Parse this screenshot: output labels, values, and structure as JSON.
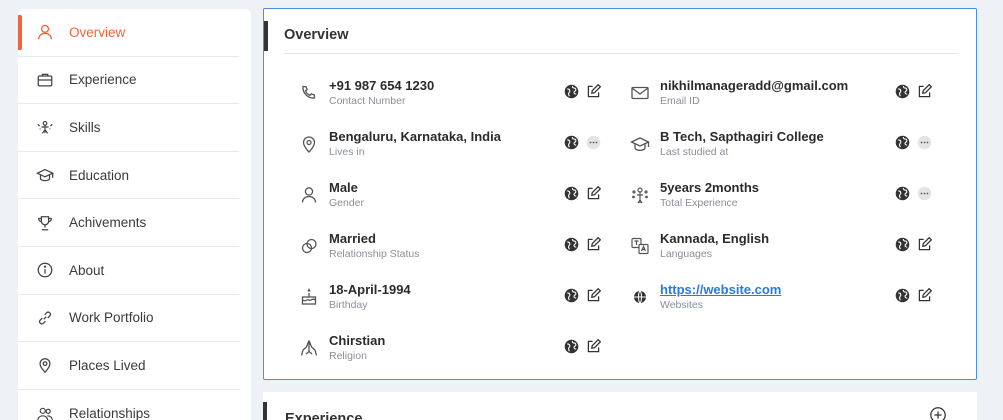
{
  "sidebar": {
    "items": [
      {
        "label": "Overview",
        "icon": "person-icon",
        "active": true
      },
      {
        "label": "Experience",
        "icon": "briefcase-icon",
        "active": false
      },
      {
        "label": "Skills",
        "icon": "skills-icon",
        "active": false
      },
      {
        "label": "Education",
        "icon": "graduation-cap-icon",
        "active": false
      },
      {
        "label": "Achivements",
        "icon": "trophy-icon",
        "active": false
      },
      {
        "label": "About",
        "icon": "info-icon",
        "active": false
      },
      {
        "label": "Work Portfolio",
        "icon": "link-icon",
        "active": false
      },
      {
        "label": "Places Lived",
        "icon": "location-pin-icon",
        "active": false
      },
      {
        "label": "Relationships",
        "icon": "people-icon",
        "active": false
      }
    ],
    "accent_color": "#f0643c"
  },
  "overview": {
    "title": "Overview",
    "fields": [
      {
        "value": "+91 987 654 1230",
        "caption": "Contact Number",
        "icon": "phone-icon",
        "action": "edit"
      },
      {
        "value": "nikhilmanageradd@gmail.com",
        "caption": "Email ID",
        "icon": "mail-icon",
        "action": "edit"
      },
      {
        "value": "Bengaluru, Karnataka, India",
        "caption": "Lives in",
        "icon": "location-pin-icon",
        "action": "more"
      },
      {
        "value": "B Tech, Sapthagiri College",
        "caption": "Last studied at",
        "icon": "graduation-cap-icon",
        "action": "more"
      },
      {
        "value": "Male",
        "caption": "Gender",
        "icon": "person-icon",
        "action": "edit"
      },
      {
        "value": "5years 2months",
        "caption": "Total Experience",
        "icon": "experience-icon",
        "action": "more"
      },
      {
        "value": "Married",
        "caption": "Relationship Status",
        "icon": "rings-icon",
        "action": "edit"
      },
      {
        "value": "Kannada, English",
        "caption": "Languages",
        "icon": "translate-icon",
        "action": "edit"
      },
      {
        "value": "18-April-1994",
        "caption": "Birthday",
        "icon": "cake-icon",
        "action": "edit"
      },
      {
        "value": "https://website.com",
        "caption": "Websites",
        "icon": "globe-icon",
        "action": "edit",
        "is_link": true
      },
      {
        "value": "Chirstian",
        "caption": "Religion",
        "icon": "praying-hands-icon",
        "action": "edit"
      }
    ],
    "border_color": "#4a8fe0",
    "link_color": "#2e78d6"
  },
  "experience": {
    "title": "Experience",
    "add_icon": "plus-circle-icon"
  }
}
